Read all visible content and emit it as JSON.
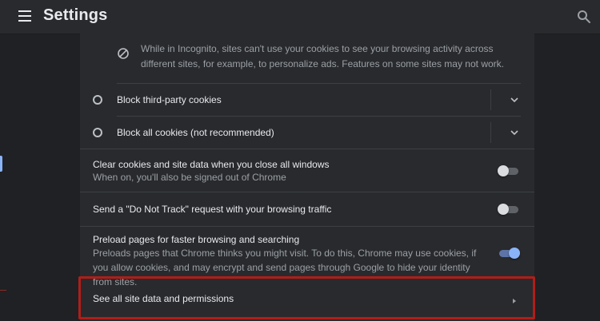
{
  "header": {
    "title": "Settings",
    "menu_icon": "hamburger-menu-icon",
    "search_icon": "search-icon"
  },
  "cookies": {
    "incognito_notice": "While in Incognito, sites can't use your cookies to see your browsing activity across different sites, for example, to personalize ads. Features on some sites may not work.",
    "notice_icon": "block-icon",
    "options": [
      {
        "label": "Block third-party cookies",
        "selected": false
      },
      {
        "label": "Block all cookies (not recommended)",
        "selected": false
      }
    ]
  },
  "settings": [
    {
      "title": "Clear cookies and site data when you close all windows",
      "subtitle": "When on, you'll also be signed out of Chrome",
      "enabled": false
    },
    {
      "title": "Send a \"Do Not Track\" request with your browsing traffic",
      "subtitle": "",
      "enabled": false
    },
    {
      "title": "Preload pages for faster browsing and searching",
      "subtitle": "Preloads pages that Chrome thinks you might visit. To do this, Chrome may use cookies, if you allow cookies, and may encrypt and send pages through Google to hide your identity from sites.",
      "enabled": true
    }
  ],
  "site_data_link": {
    "label": "See all site data and permissions",
    "icon": "chevron-right-icon"
  },
  "colors": {
    "background": "#202124",
    "card": "#292a2d",
    "accent": "#8ab4f8",
    "highlight": "#b21d18"
  }
}
